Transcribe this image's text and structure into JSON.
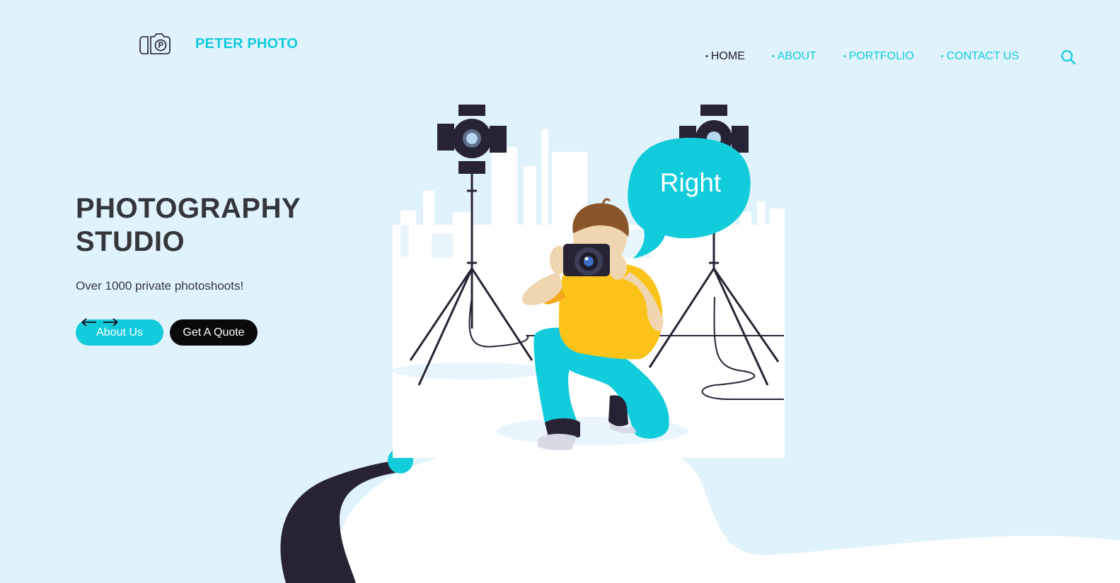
{
  "brand": {
    "name": "PETER PHOTO",
    "logo_icon": "camera-logo-icon"
  },
  "nav": {
    "items": [
      {
        "label": "HOME",
        "active": true
      },
      {
        "label": "ABOUT",
        "active": false
      },
      {
        "label": "PORTFOLIO",
        "active": false
      },
      {
        "label": "CONTACT US",
        "active": false
      }
    ],
    "bullet": "•",
    "search_icon": "search-icon"
  },
  "hero": {
    "title_line1": "PHOTOGRAPHY",
    "title_line2": "STUDIO",
    "subtitle": "Over 1000 private photoshoots!",
    "about_button": "About Us",
    "quote_button": "Get A Quote"
  },
  "illustration": {
    "speech_bubble_text": "Right"
  },
  "colors": {
    "background": "#e0f2fc",
    "accent": "#12ccdc",
    "dark": "#1b1c25",
    "text": "#33363b",
    "shirt": "#fbc31a"
  }
}
